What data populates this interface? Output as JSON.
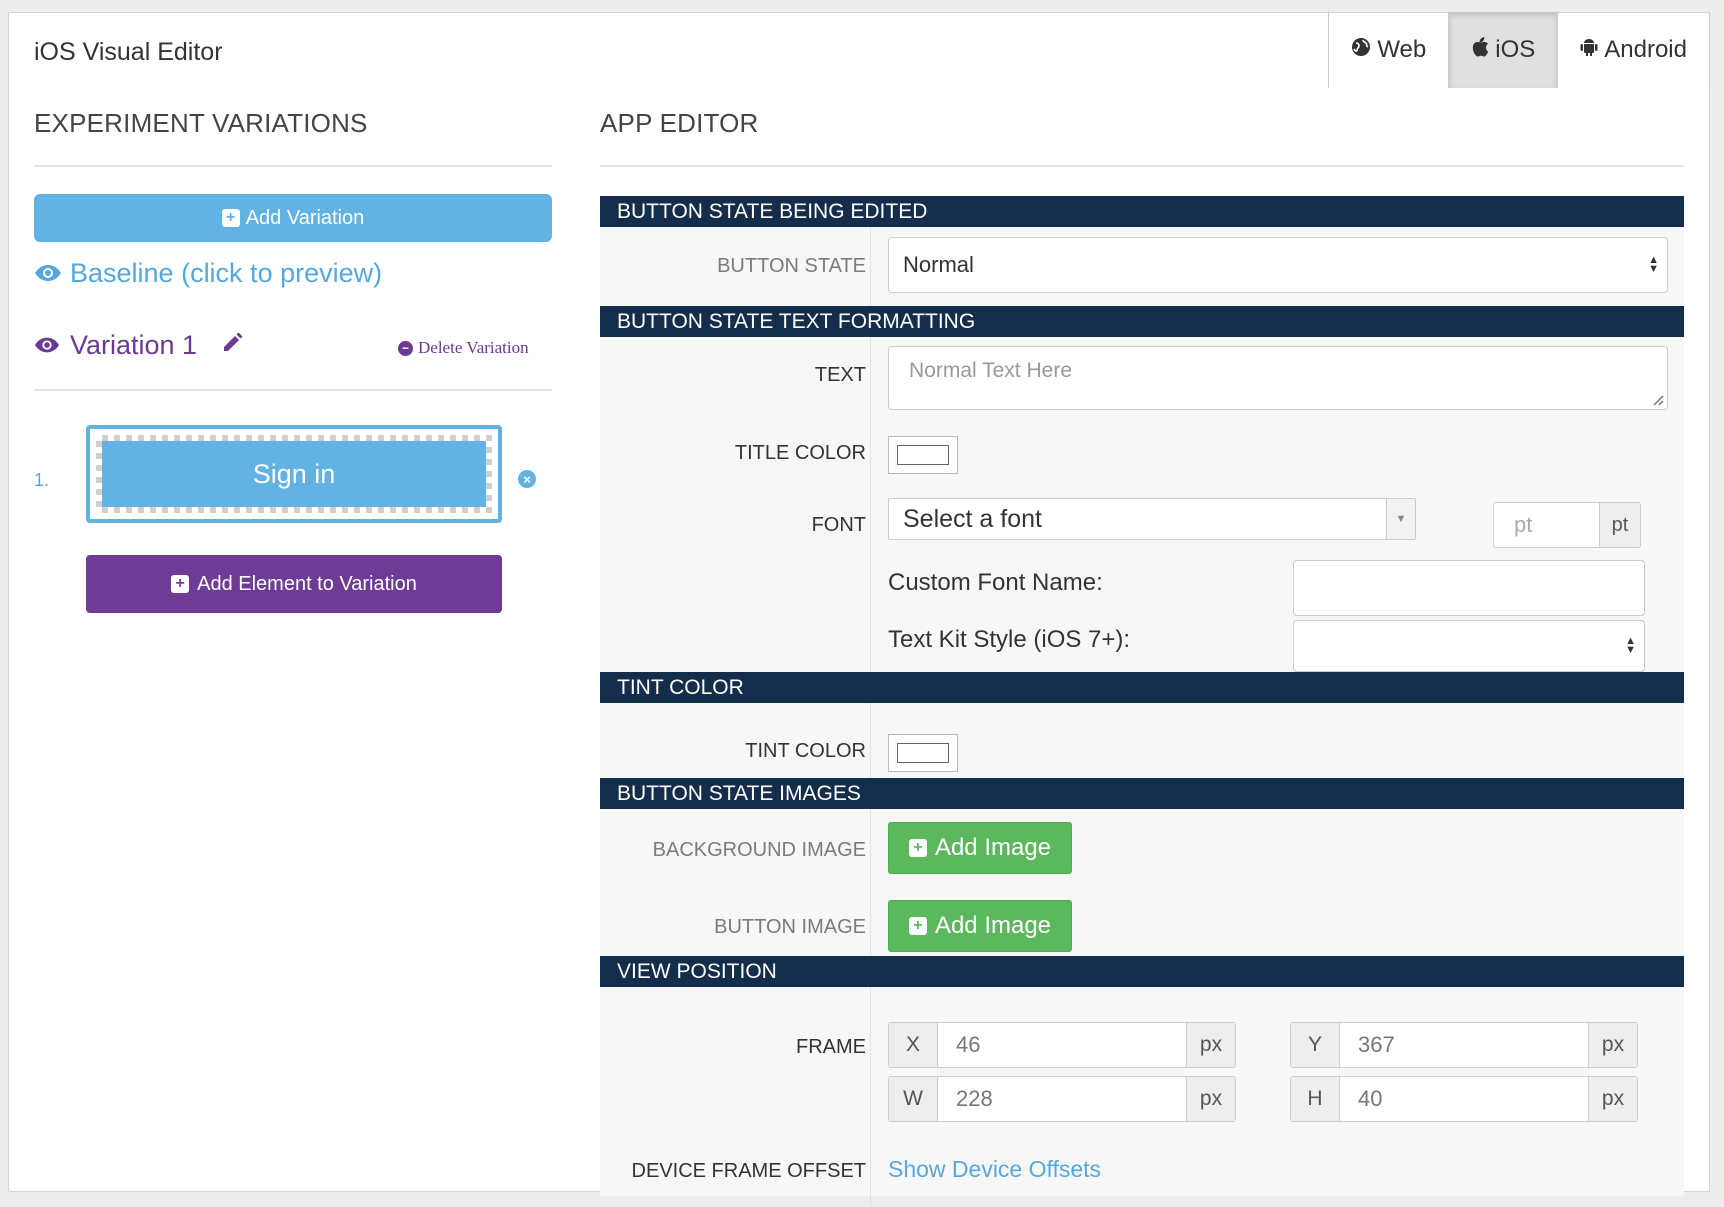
{
  "app": {
    "title": "iOS Visual Editor"
  },
  "platform_tabs": [
    {
      "label": "Web",
      "icon": "globe-icon",
      "active": false
    },
    {
      "label": "iOS",
      "icon": "apple-icon",
      "active": true
    },
    {
      "label": "Android",
      "icon": "android-icon",
      "active": false
    }
  ],
  "left": {
    "heading": "EXPERIMENT VARIATIONS",
    "add_variation": "Add Variation",
    "baseline": "Baseline (click to preview)",
    "variation_name": "Variation 1",
    "delete_variation": "Delete Variation",
    "element_index": "1.",
    "element_preview_text": "Sign in",
    "add_element": "Add Element to Variation"
  },
  "editor": {
    "heading": "APP EDITOR",
    "sections": {
      "state": "BUTTON STATE BEING EDITED",
      "text": "BUTTON STATE TEXT FORMATTING",
      "tint": "TINT COLOR",
      "images": "BUTTON STATE IMAGES",
      "position": "VIEW POSITION"
    },
    "button_state": {
      "label": "BUTTON STATE",
      "value": "Normal"
    },
    "text": {
      "label": "TEXT",
      "placeholder": "Normal Text Here"
    },
    "title_color": {
      "label": "TITLE COLOR"
    },
    "font": {
      "label": "FONT",
      "select": "Select a font",
      "size_placeholder": "pt",
      "size_unit": "pt"
    },
    "custom_font": {
      "label": "Custom Font Name:",
      "value": ""
    },
    "text_kit": {
      "label": "Text Kit Style (iOS 7+):",
      "value": ""
    },
    "tint_color": {
      "label": "TINT COLOR"
    },
    "background_image": {
      "label": "BACKGROUND IMAGE",
      "button": "Add Image"
    },
    "button_image": {
      "label": "BUTTON IMAGE",
      "button": "Add Image"
    },
    "frame": {
      "label": "FRAME",
      "x": {
        "name": "X",
        "value": "46",
        "unit": "px"
      },
      "y": {
        "name": "Y",
        "value": "367",
        "unit": "px"
      },
      "w": {
        "name": "W",
        "value": "228",
        "unit": "px"
      },
      "h": {
        "name": "H",
        "value": "40",
        "unit": "px"
      }
    },
    "device_offset": {
      "label": "DEVICE FRAME OFFSET",
      "link": "Show Device Offsets"
    }
  },
  "colors": {
    "accent_blue": "#62b2e4",
    "purple": "#6e3c97",
    "navy": "#142d4a",
    "green": "#5cb85c"
  }
}
